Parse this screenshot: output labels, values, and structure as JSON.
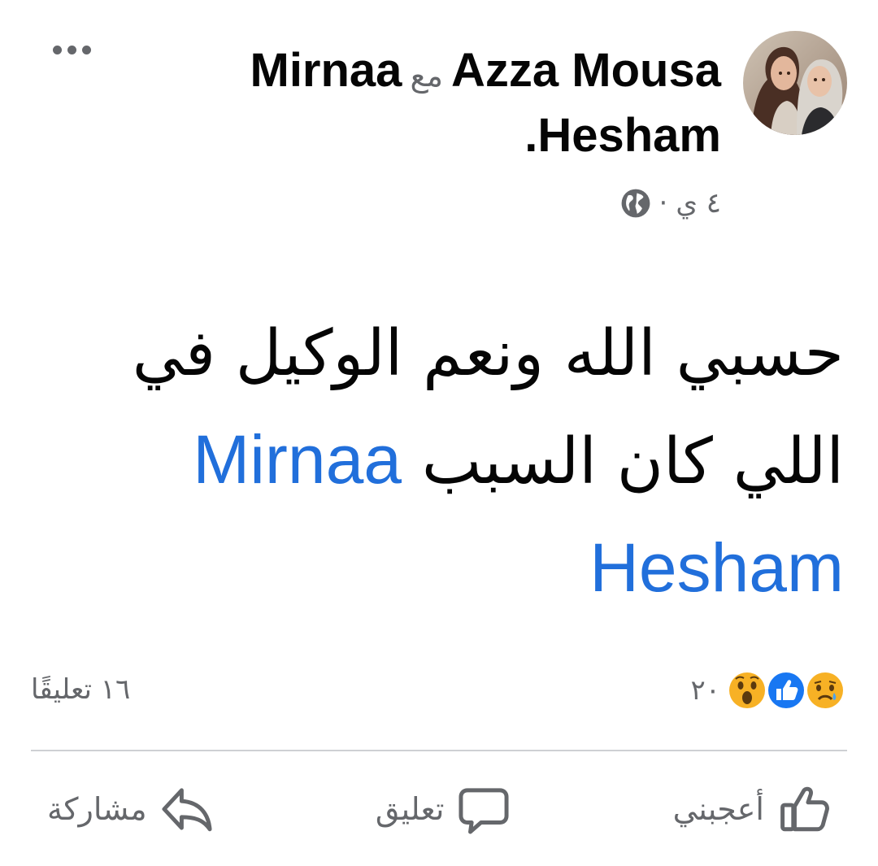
{
  "header": {
    "author_primary": "Azza Mousa",
    "with_word": "مع",
    "author_secondary_part1": "Mirnaa",
    "author_secondary_part2": "Hesham",
    "trailing_period": ".",
    "time": "٤ ي",
    "separator": "·",
    "privacy_icon": "globe-icon",
    "more_icon": "more-options-icon"
  },
  "post": {
    "text_line1": "حسبي الله ونعم الوكيل في",
    "text_line2": "اللي كان السبب",
    "mention": "Mirnaa Hesham"
  },
  "stats": {
    "reaction_count": "٢٠",
    "reactions": [
      "sad-reaction-icon",
      "like-reaction-icon",
      "wow-reaction-icon"
    ],
    "comments": "١٦ تعليقًا"
  },
  "actions": {
    "like": "أعجبني",
    "comment": "تعليق",
    "share": "مشاركة"
  },
  "colors": {
    "link_blue": "#216fdb",
    "secondary_text": "#65676b",
    "like_blue": "#1877f2",
    "reaction_yellow": "#f7b125"
  }
}
